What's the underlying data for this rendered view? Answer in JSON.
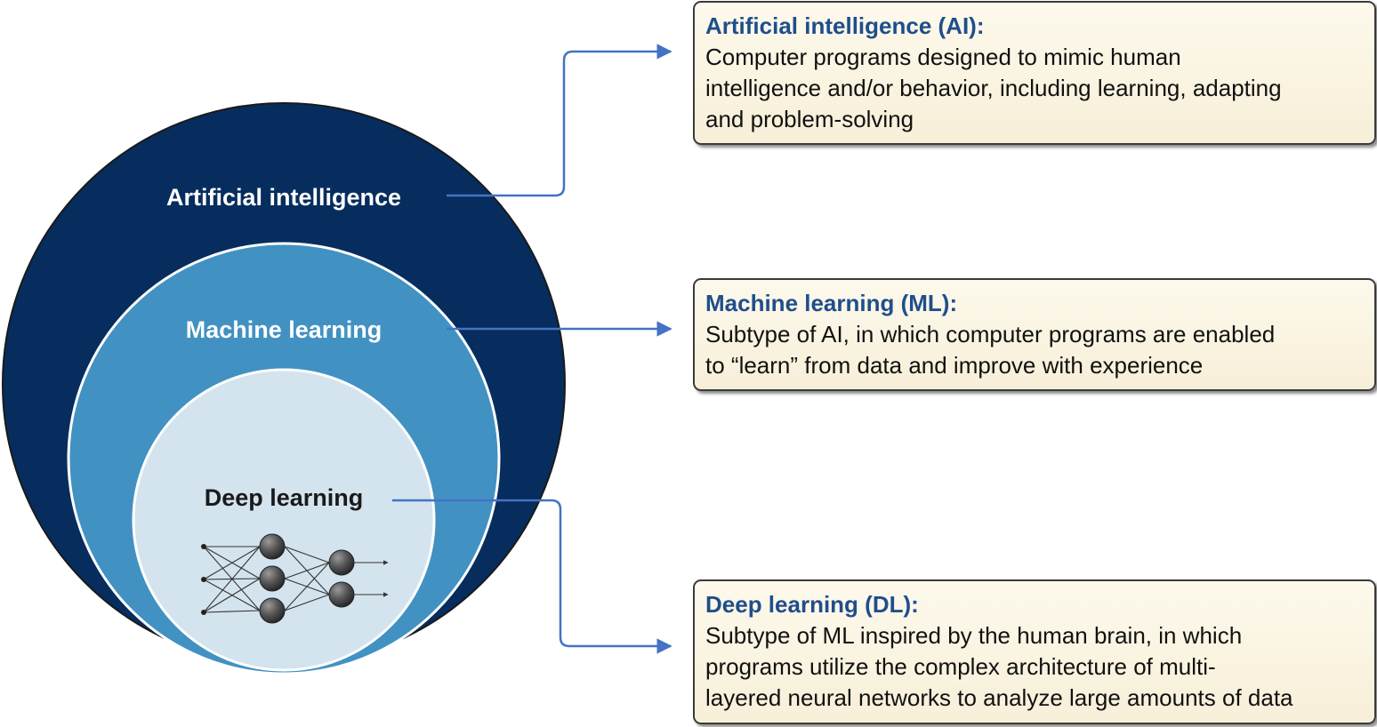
{
  "diagram": {
    "circles": {
      "ai": {
        "label": "Artificial intelligence",
        "fill": "#062d5d"
      },
      "ml": {
        "label": "Machine learning",
        "fill": "#4291c3"
      },
      "dl": {
        "label": "Deep learning",
        "fill": "#d4e4ef"
      }
    },
    "boxes": {
      "ai": {
        "title": "Artificial intelligence (AI):",
        "lines": [
          "Computer programs designed to mimic human",
          "intelligence and/or behavior, including learning, adapting",
          "and problem-solving"
        ]
      },
      "ml": {
        "title": "Machine learning (ML):",
        "lines": [
          "Subtype of AI, in which computer programs are enabled",
          "to “learn” from data and improve with experience"
        ]
      },
      "dl": {
        "title": "Deep learning (DL):",
        "lines": [
          "Subtype of ML inspired by the human brain, in which",
          "programs utilize the complex architecture of multi-",
          "layered neural networks to analyze large amounts of data"
        ]
      }
    },
    "colors": {
      "connector": "#4472c4",
      "box_title": "#1f4e8c",
      "box_border": "#3a3a3a",
      "box_fill": "#f9f3e0",
      "neuron": "#4a4a4a"
    }
  }
}
